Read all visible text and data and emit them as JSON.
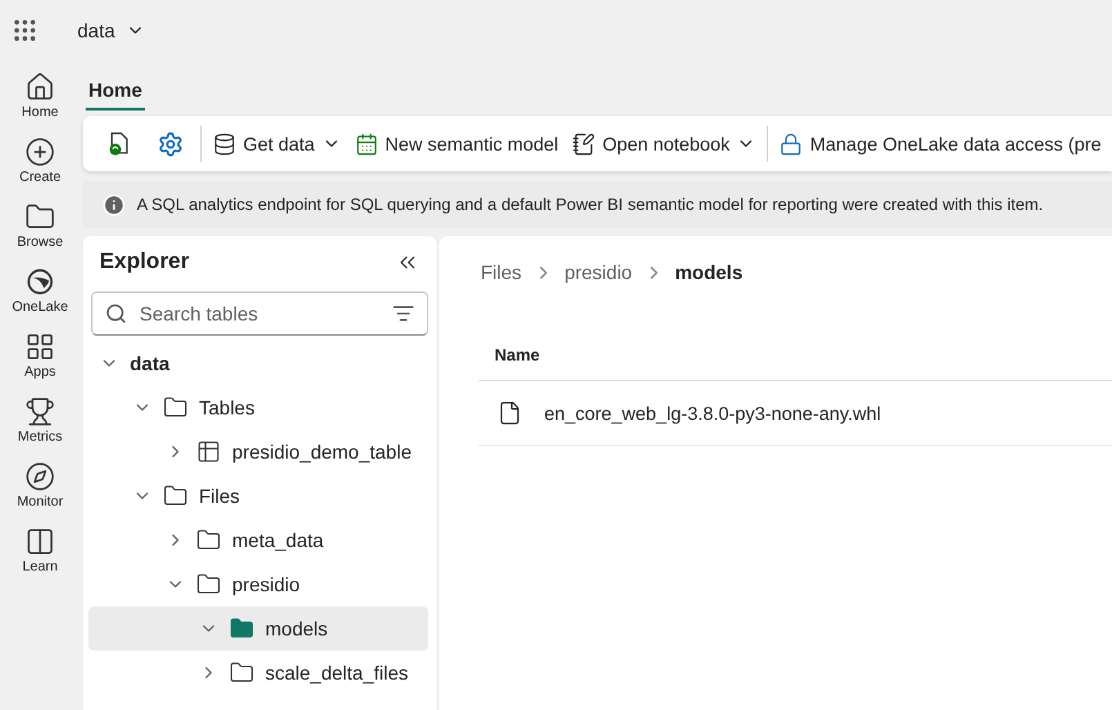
{
  "topbar": {
    "workspace": "data"
  },
  "rail": [
    {
      "label": "Home"
    },
    {
      "label": "Create"
    },
    {
      "label": "Browse"
    },
    {
      "label": "OneLake"
    },
    {
      "label": "Apps"
    },
    {
      "label": "Metrics"
    },
    {
      "label": "Monitor"
    },
    {
      "label": "Learn"
    }
  ],
  "ribbon_tabs": [
    {
      "label": "Home",
      "selected": true
    }
  ],
  "toolbar": [
    {
      "kind": "icon"
    },
    {
      "kind": "icon"
    },
    {
      "kind": "separator"
    },
    {
      "kind": "button",
      "label": "Get data",
      "dropdown": true
    },
    {
      "kind": "button",
      "label": "New semantic model",
      "dropdown": false
    },
    {
      "kind": "button",
      "label": "Open notebook",
      "dropdown": true
    },
    {
      "kind": "separator"
    },
    {
      "kind": "button",
      "label": "Manage OneLake data access (pre",
      "dropdown": false
    }
  ],
  "info_bar": {
    "message": "A SQL analytics endpoint for SQL querying and a default Power BI semantic model for reporting were created with this item."
  },
  "explorer": {
    "title": "Explorer",
    "search": {
      "placeholder": "Search tables"
    },
    "tree": [
      {
        "label": "data",
        "kind": "root",
        "expanded": true,
        "selected": false,
        "children": [
          {
            "label": "Tables",
            "kind": "folder",
            "expanded": true,
            "selected": false,
            "children": [
              {
                "label": "presidio_demo_table",
                "kind": "table",
                "expanded": false,
                "selected": false
              }
            ]
          },
          {
            "label": "Files",
            "kind": "folder",
            "expanded": true,
            "selected": false,
            "children": [
              {
                "label": "meta_data",
                "kind": "folder",
                "expanded": false,
                "selected": false
              },
              {
                "label": "presidio",
                "kind": "folder",
                "expanded": true,
                "selected": false,
                "children": [
                  {
                    "label": "models",
                    "kind": "folder",
                    "expanded": true,
                    "selected": true
                  },
                  {
                    "label": "scale_delta_files",
                    "kind": "folder",
                    "expanded": false,
                    "selected": false
                  }
                ]
              }
            ]
          }
        ]
      }
    ]
  },
  "breadcrumb": [
    {
      "label": "Files",
      "current": false
    },
    {
      "label": "presidio",
      "current": false
    },
    {
      "label": "models",
      "current": true
    }
  ],
  "file_table": {
    "columns": [
      "Name"
    ],
    "rows": [
      {
        "name": "en_core_web_lg-3.8.0-py3-none-any.whl"
      }
    ]
  }
}
